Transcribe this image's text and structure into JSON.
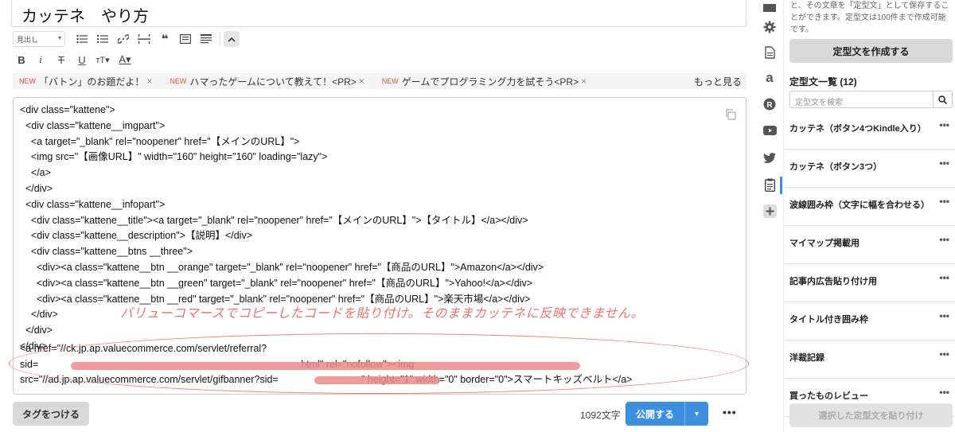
{
  "article": {
    "title": "カッテネ　やり方"
  },
  "toolbar": {
    "heading_select": "見出し",
    "caret": "▾",
    "icons_row1": [
      "unordered-list-icon",
      "ordered-list-icon",
      "link-icon",
      "hr-icon",
      "quote-icon",
      "table-icon",
      "align-icon",
      "collapse-up-icon"
    ],
    "icons_row2": [
      "bold-icon",
      "italic-icon",
      "strikethrough-icon",
      "underline-icon",
      "font-size-icon",
      "font-color-icon"
    ]
  },
  "topics": [
    {
      "badge": "NEW",
      "text": "「バトン」のお題だよ！",
      "close": "×"
    },
    {
      "badge": "NEW",
      "text": "ハマったゲームについて教えて！<PR>",
      "close": "×"
    },
    {
      "badge": "NEW",
      "text": "ゲームでプログラミング力を試そう<PR>",
      "close": "×"
    }
  ],
  "topics_more": "もっと見る",
  "editor": {
    "code_lines": [
      "<div class=\"kattene\">",
      "  <div class=\"kattene__imgpart\">",
      "    <a target=\"_blank\" rel=\"noopener\" href=\"【メインのURL】\">",
      "    <img src=\"【画像URL】\" width=\"160\" height=\"160\" loading=\"lazy\">",
      "    </a>",
      "  </div>",
      "  <div class=\"kattene__infopart\">",
      "    <div class=\"kattene__title\"><a target=\"_blank\" rel=\"noopener\" href=\"【メインのURL】\">【タイトル】</a></div>",
      "    <div class=\"kattene__description\">【説明】</div>",
      "    <div class=\"kattene__btns __three\">",
      "      <div><a class=\"kattene__btn __orange\" target=\"_blank\" rel=\"noopener\" href=\"【商品のURL】\">Amazon</a></div>",
      "      <div><a class=\"kattene__btn __green\" target=\"_blank\" rel=\"noopener\" href=\"【商品のURL】\">Yahoo!</a></div>",
      "      <div><a class=\"kattene__btn __red\" target=\"_blank\" rel=\"noopener\" href=\"【商品のURL】\">楽天市場</a></div>",
      "    </div>",
      "  </div>",
      "</div>"
    ],
    "annotation": "バリューコマースでコピーしたコードを貼り付け。そのままカッテネに反映できません。",
    "pasted_lines": [
      "<a href=\"//ck.jp.ap.valuecommerce.com/servlet/referral?",
      "sid=                                                                                              .html\" rel=\"nofollow\"><img",
      "src=\"//ad.jp.ap.valuecommerce.com/servlet/gifbanner?sid=                              \" height=\"1\" width=\"0\" border=\"0\">スマートキッズベルト</a>"
    ]
  },
  "footer": {
    "tag_button": "タグをつける",
    "char_count": "1092文字",
    "publish": "公開する",
    "publish_dropdown": "▾",
    "more": "•••"
  },
  "sidebar_icons": [
    "folder-icon",
    "gear-icon",
    "document-icon",
    "amazon-icon",
    "rakuten-icon",
    "youtube-icon",
    "twitter-icon",
    "clipboard-icon",
    "plus-icon"
  ],
  "panel": {
    "description": "と、その文章を「定型文」として保存することができます。定型文は100件まで作成可能です。",
    "create_button": "定型文を作成する",
    "list_title": "定型文一覧 (12)",
    "search_placeholder": "定型文を検索",
    "items": [
      "カッテネ（ボタン4つKindle入り）",
      "カッテネ（ボタン3つ）",
      "波線囲み枠（文字に幅を合わせる）",
      "マイマップ掲載用",
      "記事内広告貼り付け用",
      "タイトル付き囲み枠",
      "洋裁記録",
      "買ったものレビュー"
    ],
    "item_more": "•••",
    "paste_button": "選択した定型文を貼り付け"
  }
}
